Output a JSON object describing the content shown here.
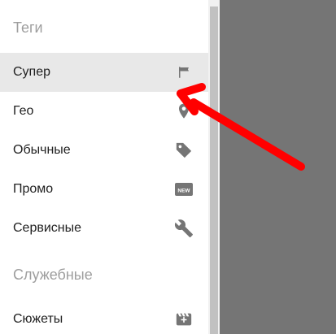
{
  "drawer": {
    "section_tags": "Теги",
    "section_service": "Служебные",
    "items": [
      {
        "label": "Супер",
        "icon": "flag-icon",
        "active": true
      },
      {
        "label": "Гео",
        "icon": "location-pin-icon",
        "active": false
      },
      {
        "label": "Обычные",
        "icon": "tag-icon",
        "active": false
      },
      {
        "label": "Промо",
        "icon": "new-badge-icon",
        "active": false
      },
      {
        "label": "Сервисные",
        "icon": "wrench-icon",
        "active": false
      },
      {
        "label": "Сюжеты",
        "icon": "movie-clapper-icon",
        "active": false
      }
    ]
  },
  "colors": {
    "icon": "#757575",
    "active_background": "#e8e8e8",
    "overlay": "#757575",
    "annotation_arrow": "#ff0000"
  },
  "annotation": {
    "arrow_target": "flag-icon"
  }
}
